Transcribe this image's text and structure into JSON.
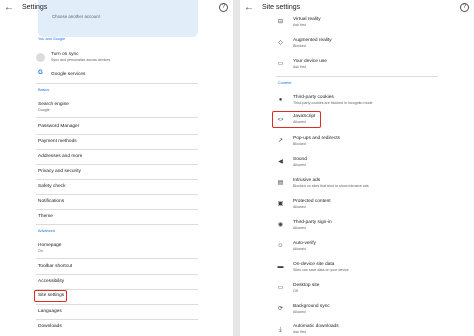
{
  "left": {
    "title": "Settings",
    "banner_text": "Choose another account",
    "sections": {
      "you_and_google": "You and Google",
      "basics": "Basics",
      "advanced": "Advanced"
    },
    "sync": {
      "label": "Turn on sync",
      "sub": "Sync and personalize across devices"
    },
    "google_services": "Google services",
    "search_engine": {
      "label": "Search engine",
      "sub": "Google"
    },
    "items": {
      "password_manager": "Password Manager",
      "payment_methods": "Payment methods",
      "addresses": "Addresses and more",
      "privacy": "Privacy and security",
      "safety_check": "Safety check",
      "notifications": "Notifications",
      "theme": "Theme",
      "homepage": "Homepage",
      "homepage_sub": "On",
      "toolbar_shortcut": "Toolbar shortcut",
      "accessibility": "Accessibility",
      "site_settings": "Site settings",
      "languages": "Languages",
      "downloads": "Downloads"
    }
  },
  "right": {
    "title": "Site settings",
    "content_header": "Content",
    "items": [
      {
        "label": "Virtual reality",
        "sub": "Ask first",
        "icon": "vr-icon"
      },
      {
        "label": "Augmented reality",
        "sub": "Blocked",
        "icon": "ar-icon"
      },
      {
        "label": "Your device use",
        "sub": "Ask first",
        "icon": "device-use-icon"
      },
      {
        "label": "Third-party cookies",
        "sub": "Third-party cookies are blocked in Incognito mode",
        "icon": "cookie-icon"
      },
      {
        "label": "JavaScript",
        "sub": "Allowed",
        "icon": "code-icon"
      },
      {
        "label": "Pop-ups and redirects",
        "sub": "Blocked",
        "icon": "popup-icon"
      },
      {
        "label": "Sound",
        "sub": "Allowed",
        "icon": "sound-icon"
      },
      {
        "label": "Intrusive ads",
        "sub": "Blocked on sites that tend to show intrusive ads",
        "icon": "ads-icon"
      },
      {
        "label": "Protected content",
        "sub": "Allowed",
        "icon": "protected-icon"
      },
      {
        "label": "Third-party sign-in",
        "sub": "Allowed",
        "icon": "signin-icon"
      },
      {
        "label": "Auto-verify",
        "sub": "Allowed",
        "icon": "verify-icon"
      },
      {
        "label": "On-device site data",
        "sub": "Sites can save data on your device",
        "icon": "storage-icon"
      },
      {
        "label": "Desktop site",
        "sub": "Off",
        "icon": "desktop-icon"
      },
      {
        "label": "Background sync",
        "sub": "Allowed",
        "icon": "sync-icon"
      },
      {
        "label": "Automatic downloads",
        "sub": "Ask first",
        "icon": "download-icon"
      }
    ]
  }
}
